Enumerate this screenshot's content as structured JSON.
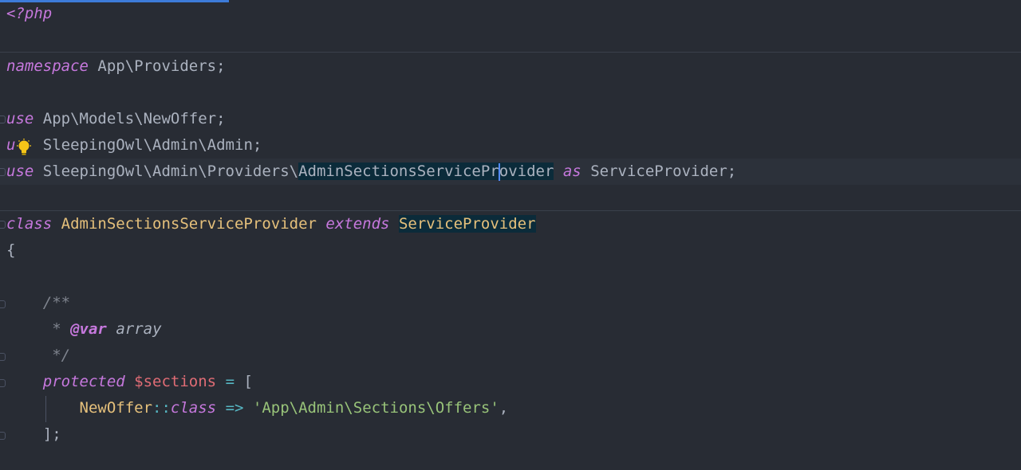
{
  "code": {
    "php_open": "<?php",
    "namespace_kw": "namespace",
    "namespace_name": "App\\Providers;",
    "use_kw": "use",
    "use1": "App\\Models\\NewOffer;",
    "use2_kw_part": "u",
    "use2": "SleepingOwl\\Admin\\Admin;",
    "use3_prefix": "SleepingOwl\\Admin\\Providers\\",
    "use3_sel_a": "AdminSectionsServicePr",
    "use3_sel_b": "ovider",
    "as_kw": "as",
    "use3_alias": "ServiceProvider;",
    "class_kw": "class",
    "class_name": "AdminSectionsServiceProvider",
    "extends_kw": "extends",
    "parent_class": "ServiceProvider",
    "brace_open": "{",
    "doc_open": "/**",
    "doc_star": "*",
    "doc_tag": "@var",
    "doc_type": "array",
    "doc_close": "*/",
    "protected_kw": "protected",
    "prop_name": "$sections",
    "assign": "=",
    "bracket_open": "[",
    "entry_class": "NewOffer",
    "entry_scope": "::",
    "entry_class_kw": "class",
    "entry_arrow": "=>",
    "entry_value": "'App\\Admin\\Sections\\Offers'",
    "entry_comma": ",",
    "bracket_close": "];"
  },
  "icons": {
    "intention": "lightbulb-icon",
    "fold": "fold-marker-icon"
  },
  "colors": {
    "background": "#282c34",
    "keyword": "#c678dd",
    "class": "#e5c07b",
    "variable": "#e06c75",
    "string": "#98c379",
    "operator": "#56b6c2",
    "comment": "#7f848e",
    "bulb": "#f5c518"
  }
}
